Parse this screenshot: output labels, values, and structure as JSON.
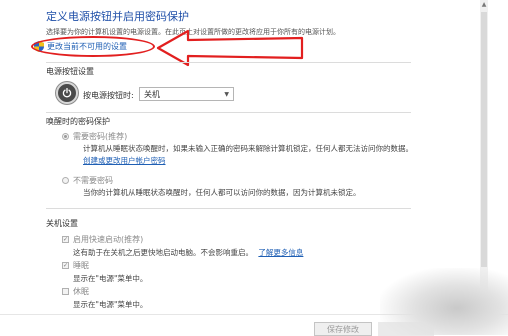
{
  "header": {
    "title": "定义电源按钮并启用密码保护",
    "subtitle": "选择要为你的计算机设置的电源设置。在此页上对设置所做的更改将应用于你所有的电源计划。",
    "change_link": "更改当前不可用的设置"
  },
  "power_button": {
    "section_title": "电源按钮设置",
    "label": "按电源按钮时:",
    "selected_value": "关机"
  },
  "wake_password": {
    "section_title": "唤醒时的密码保护",
    "option_required": "需要密码(推荐)",
    "required_desc_1": "计算机从睡眠状态唤醒时，如果未输入正确的密码来解除计算机锁定，任何人都无法访问你的数据。",
    "required_link": "创建或更改用户帐户密码",
    "option_not_required": "不需要密码",
    "not_required_desc": "当你的计算机从睡眠状态唤醒时，任何人都可以访问你的数据，因为计算机未锁定。"
  },
  "shutdown": {
    "section_title": "关机设置",
    "fast_startup_label": "启用快速启动(推荐)",
    "fast_startup_desc": "这有助于在关机之后更快地启动电脑。不会影响重启。",
    "fast_startup_link": "了解更多信息",
    "sleep_label": "睡眠",
    "sleep_desc": "显示在\"电源\"菜单中。",
    "hibernate_label": "休眠",
    "hibernate_desc": "显示在\"电源\"菜单中。"
  },
  "footer": {
    "save_label": "保存修改"
  },
  "colors": {
    "title_blue": "#1f4fa8",
    "link_blue": "#1f5fb4",
    "annotation_red": "#e21f1f"
  }
}
